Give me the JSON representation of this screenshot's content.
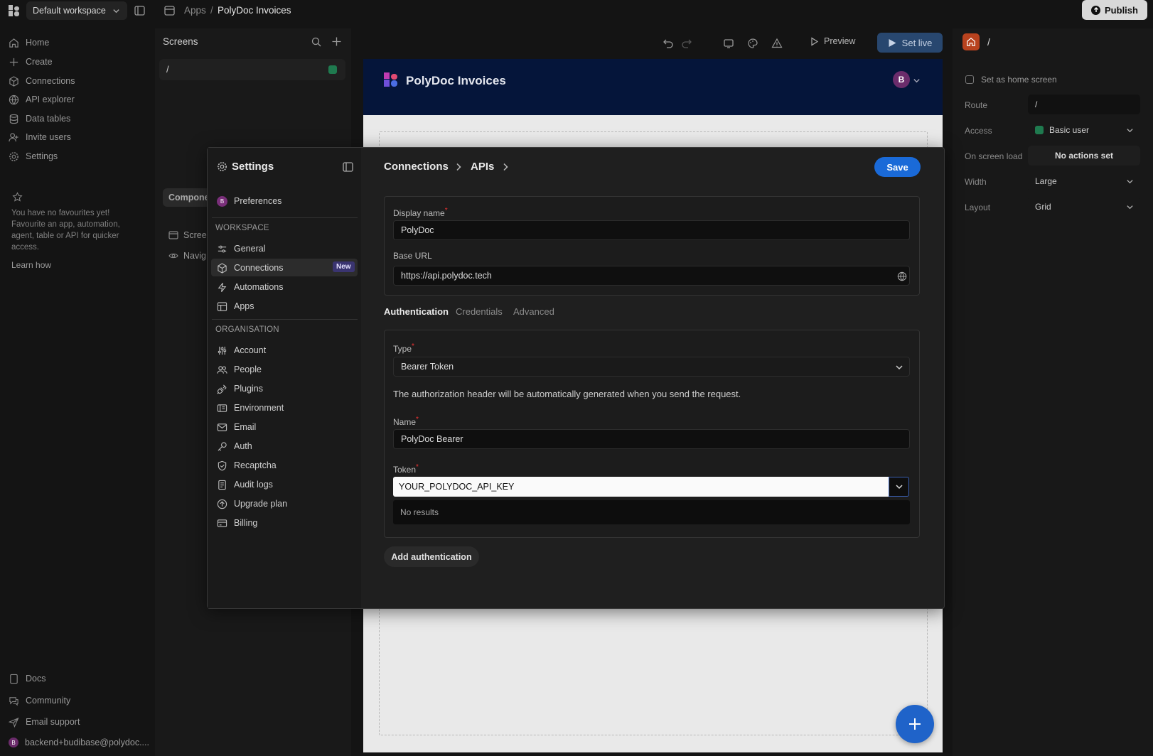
{
  "topbar": {
    "workspace": "Default workspace",
    "breadcrumb_root": "Apps",
    "breadcrumb_sep": "/",
    "breadcrumb_app": "PolyDoc Invoices",
    "publish_label": "Publish"
  },
  "nav": {
    "items": [
      {
        "label": "Home",
        "icon": "home-icon"
      },
      {
        "label": "Create",
        "icon": "plus-icon"
      },
      {
        "label": "Connections",
        "icon": "cube-icon"
      },
      {
        "label": "API explorer",
        "icon": "globe-icon"
      },
      {
        "label": "Data tables",
        "icon": "database-icon"
      },
      {
        "label": "Invite users",
        "icon": "user-plus-icon"
      },
      {
        "label": "Settings",
        "icon": "gear-icon"
      }
    ],
    "fav_text": "You have no favourites yet! Favourite an app, automation, agent, table or API for quicker access.",
    "learn_how": "Learn how",
    "bottom": [
      {
        "label": "Docs",
        "icon": "doc-icon"
      },
      {
        "label": "Community",
        "icon": "community-icon"
      },
      {
        "label": "Email support",
        "icon": "send-icon"
      }
    ],
    "user_email": "backend+budibase@polydoc....",
    "user_initial": "B"
  },
  "screens": {
    "title": "Screens",
    "route": "/",
    "components_tab": "Compone",
    "tree": [
      {
        "label": "Scree"
      },
      {
        "label": "Navig"
      }
    ]
  },
  "canvas": {
    "preview_label": "Preview",
    "setlive_label": "Set live",
    "app_title": "PolyDoc Invoices",
    "avatar_initial": "B"
  },
  "properties": {
    "route_slash": "/",
    "home_screen_label": "Set as home screen",
    "route_label": "Route",
    "route_value": "/",
    "access_label": "Access",
    "access_value": "Basic user",
    "onload_label": "On screen load",
    "onload_value": "No actions set",
    "width_label": "Width",
    "width_value": "Large",
    "layout_label": "Layout",
    "layout_value": "Grid"
  },
  "settings": {
    "title": "Settings",
    "preferences": "Preferences",
    "pref_initial": "B",
    "workspace_heading": "WORKSPACE",
    "workspace_items": [
      "General",
      "Connections",
      "Automations",
      "Apps"
    ],
    "new_badge": "New",
    "org_heading": "ORGANISATION",
    "org_items": [
      "Account",
      "People",
      "Plugins",
      "Environment",
      "Email",
      "Auth",
      "Recaptcha",
      "Audit logs",
      "Upgrade plan",
      "Billing"
    ]
  },
  "form": {
    "crumb1": "Connections",
    "crumb2": "APIs",
    "save_label": "Save",
    "display_name_label": "Display name",
    "display_name_value": "PolyDoc",
    "base_url_label": "Base URL",
    "base_url_value": "https://api.polydoc.tech",
    "tabs": [
      "Authentication",
      "Credentials",
      "Advanced"
    ],
    "type_label": "Type",
    "type_value": "Bearer Token",
    "help_text": "The authorization header will be automatically generated when you send the request.",
    "name_label": "Name",
    "name_value": "PolyDoc Bearer",
    "token_label": "Token",
    "token_value": "YOUR_POLYDOC_API_KEY",
    "no_results": "No results",
    "add_auth_label": "Add authentication",
    "required_mark": "*"
  }
}
